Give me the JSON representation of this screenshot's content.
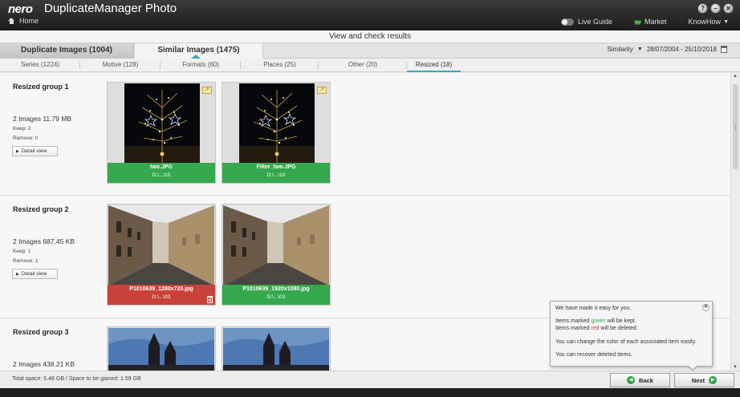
{
  "app": {
    "brand": "nero",
    "title": "DuplicateManager Photo",
    "home_label": "Home",
    "live_guide_label": "Live Guide",
    "market_label": "Market",
    "knowhow_label": "KnowHow",
    "window_buttons": [
      "?",
      "–",
      "✕"
    ]
  },
  "header": {
    "title": "View and check results"
  },
  "main_tabs": [
    {
      "label": "Duplicate Images (1004)",
      "active": false
    },
    {
      "label": "Similar Images (1475)",
      "active": true
    }
  ],
  "filter": {
    "sort_label": "Similarity",
    "date_range": "28/07/2004 - 25/10/2018"
  },
  "sub_tabs": [
    {
      "label": "Series (1224)",
      "active": false
    },
    {
      "label": "Motive (128)",
      "active": false
    },
    {
      "label": "Formats (60)",
      "active": false
    },
    {
      "label": "Places (25)",
      "active": false
    },
    {
      "label": "Other (20)",
      "active": false
    },
    {
      "label": "Resized (18)",
      "active": true
    }
  ],
  "groups": [
    {
      "title": "Resized group 1",
      "info": "2 Images  11.79 MB",
      "keep": "Keep: 2",
      "remove": "Remove: 0",
      "detail_label": "Detail view",
      "images": [
        {
          "name": "two.JPG",
          "path": "D:\\...\\10",
          "status": "keep"
        },
        {
          "name": "Filter_two.JPG",
          "path": "D:\\...\\10",
          "status": "keep"
        }
      ]
    },
    {
      "title": "Resized group 2",
      "info": "2 Images  687.45 KB",
      "keep": "Keep: 1",
      "remove": "Remove: 1",
      "detail_label": "Detail view",
      "images": [
        {
          "name": "P1010639_1280x720.jpg",
          "path": "D:\\...\\03",
          "status": "delete"
        },
        {
          "name": "P1010639_1920x1080.jpg",
          "path": "D:\\...\\03",
          "status": "keep"
        }
      ]
    },
    {
      "title": "Resized group 3",
      "info": "2 Images  438.21 KB"
    }
  ],
  "tooltip": {
    "line1": "We have made it easy for you.",
    "kept_prefix": "Items marked ",
    "kept_word": "green",
    "kept_suffix": " will be kept.",
    "deleted_prefix": "Items marked ",
    "deleted_word": "red",
    "deleted_suffix": " will be deleted.",
    "line4": "You can change the color of each associated item easily.",
    "line5": "You can recover deleted items."
  },
  "footer": {
    "space_text": "Total space: 5.48 GB / Space to be gained: 1.59 GB",
    "back_label": "Back",
    "next_label": "Next"
  },
  "colors": {
    "keep": "#36a84d",
    "delete": "#c9423a",
    "accent": "#3fa6bf"
  }
}
